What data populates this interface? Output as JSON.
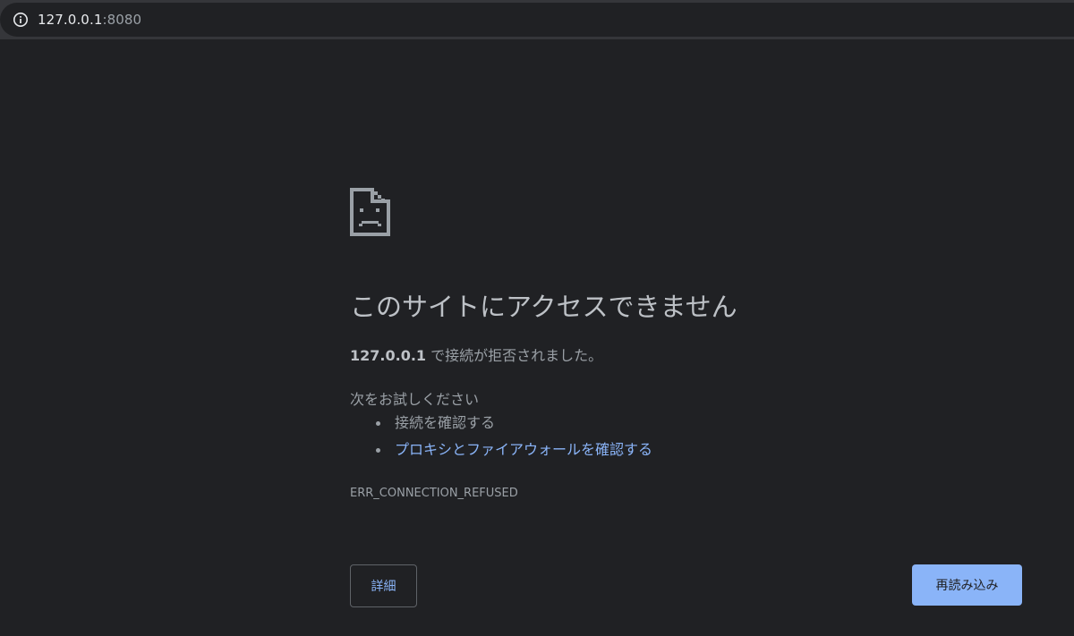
{
  "browser": {
    "url_host": "127.0.0.1",
    "url_port": ":8080",
    "info_icon": "info-icon"
  },
  "error_page": {
    "icon": "sad-page-icon",
    "title": "このサイトにアクセスできません",
    "host": "127.0.0.1",
    "message": " で接続が拒否されました。",
    "suggestions_heading": "次をお試しください",
    "suggestions": [
      {
        "text": "接続を確認する",
        "is_link": false
      },
      {
        "text": "プロキシとファイアウォールを確認する",
        "is_link": true
      }
    ],
    "error_code": "ERR_CONNECTION_REFUSED",
    "details_label": "詳細",
    "reload_label": "再読み込み"
  },
  "colors": {
    "background": "#202124",
    "toolbar": "#35363a",
    "title": "#bdc1c6",
    "body_text": "#9aa0a6",
    "link": "#8ab4f8",
    "primary_button": "#8ab4f8"
  }
}
